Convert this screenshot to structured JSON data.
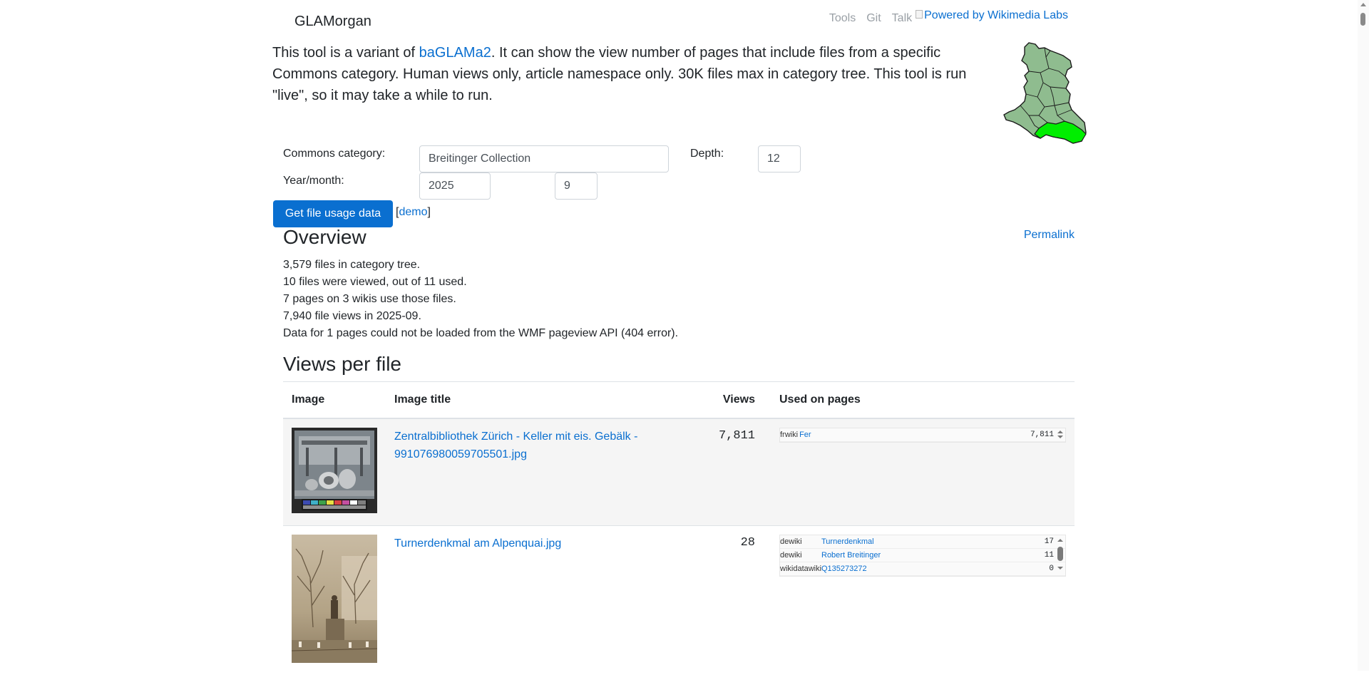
{
  "nav": {
    "brand": "GLAMorgan",
    "links": [
      "Tools",
      "Git",
      "Talk"
    ],
    "powered_alt": "Powered by Wikimedia Labs"
  },
  "intro": {
    "before_link": "This tool is a variant of ",
    "link": "baGLAMa2",
    "after_link": ". It can show the view number of pages that include files from a specific Commons category. Human views only, article namespace only. 30K files max in category tree. This tool is run \"live\", so it may take a while to run."
  },
  "form": {
    "category_label": "Commons category:",
    "category_value": "Breitinger Collection",
    "depth_label": "Depth:",
    "depth_value": "12",
    "yearmonth_label": "Year/month:",
    "year_value": "2025",
    "month_value": "9",
    "submit_label": "Get file usage data",
    "demo_open": "[",
    "demo_label": "demo",
    "demo_close": "]"
  },
  "overview": {
    "heading": "Overview",
    "permalink": "Permalink",
    "lines": [
      "3,579 files in category tree.",
      "10 files were viewed, out of 11 used.",
      "7 pages on 3 wikis use those files.",
      "7,940 file views in 2025-09.",
      "Data for 1 pages could not be loaded from the WMF pageview API (404 error)."
    ]
  },
  "views": {
    "heading": "Views per file",
    "columns": [
      "Image",
      "Image title",
      "Views",
      "Used on pages"
    ],
    "rows": [
      {
        "title": "Zentralbibliothek Zürich - Keller mit eis. Gebälk - 991076980059705501.jpg",
        "views": "7,811",
        "usage": [
          {
            "wiki": "frwiki",
            "page": "Fer",
            "count": "7,811"
          }
        ]
      },
      {
        "title": "Turnerdenkmal am Alpenquai.jpg",
        "views": "28",
        "usage": [
          {
            "wiki": "dewiki",
            "page": "Turnerdenkmal",
            "count": "17"
          },
          {
            "wiki": "dewiki",
            "page": "Robert Breitinger",
            "count": "11"
          },
          {
            "wiki": "wikidatawiki",
            "page": "Q135273272",
            "count": "0"
          }
        ]
      }
    ]
  },
  "colors": {
    "link": "#0a6fd0",
    "button": "#0a6fd0",
    "map_fill": "#8fbc8f",
    "map_highlight": "#00ee00"
  }
}
